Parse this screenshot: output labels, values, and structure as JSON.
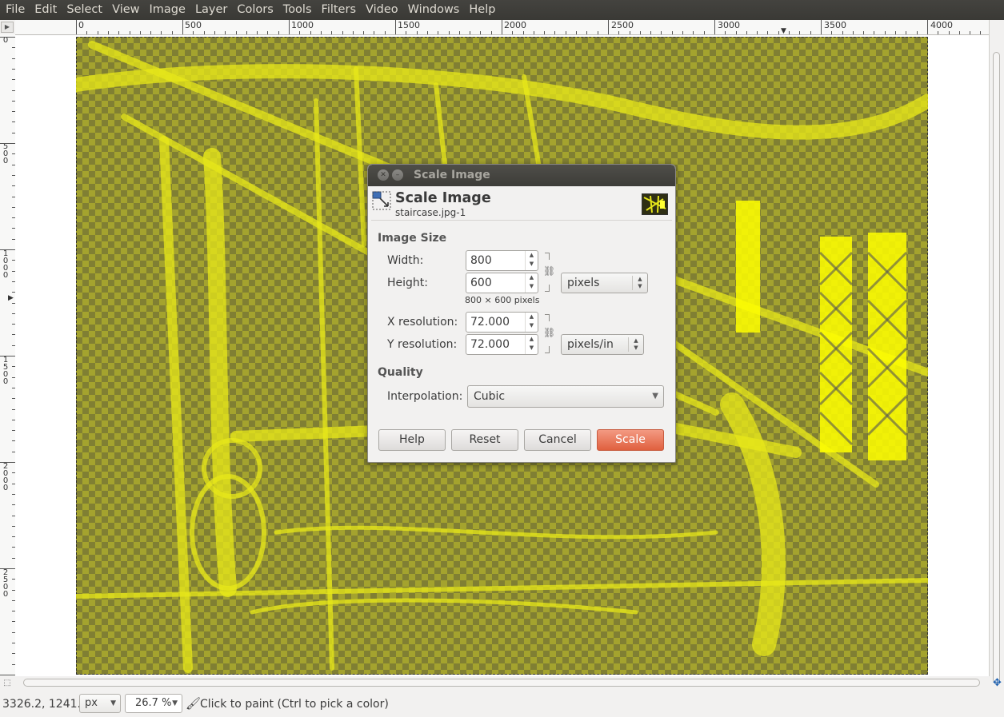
{
  "menubar": {
    "items": [
      "File",
      "Edit",
      "Select",
      "View",
      "Image",
      "Layer",
      "Colors",
      "Tools",
      "Filters",
      "Video",
      "Windows",
      "Help"
    ]
  },
  "rulers": {
    "horizontal_labels": [
      "0",
      "500",
      "1000",
      "1500",
      "2000",
      "2500",
      "3000",
      "3500",
      "4000"
    ],
    "vertical_labels": [
      "0",
      "500",
      "1000",
      "1500",
      "2000",
      "2500"
    ]
  },
  "canvas": {
    "image_tint": "#d6d61e",
    "checker_dark": "#7d7d56"
  },
  "dialog": {
    "window_title": "Scale Image",
    "heading": "Scale Image",
    "subheading": "staircase.jpg-1",
    "image_size_title": "Image Size",
    "width_label": "Width:",
    "width_value": "800",
    "height_label": "Height:",
    "height_value": "600",
    "size_unit": "pixels",
    "size_hint": "800 × 600 pixels",
    "xres_label": "X resolution:",
    "xres_value": "72.000",
    "yres_label": "Y resolution:",
    "yres_value": "72.000",
    "res_unit": "pixels/in",
    "quality_title": "Quality",
    "interp_label": "Interpolation:",
    "interp_value": "Cubic",
    "buttons": {
      "help": "Help",
      "reset": "Reset",
      "cancel": "Cancel",
      "scale": "Scale"
    },
    "accent_color": "#e9704f"
  },
  "status": {
    "coords": "3326.2, 1241.2",
    "unit": "px",
    "zoom": "26.7 %",
    "message": "Click to paint (Ctrl to pick a color)"
  },
  "icons": [
    "paintbrush-icon",
    "navigate-icon",
    "quick-mask-icon",
    "chain-link-icon",
    "scale-image-icon"
  ]
}
